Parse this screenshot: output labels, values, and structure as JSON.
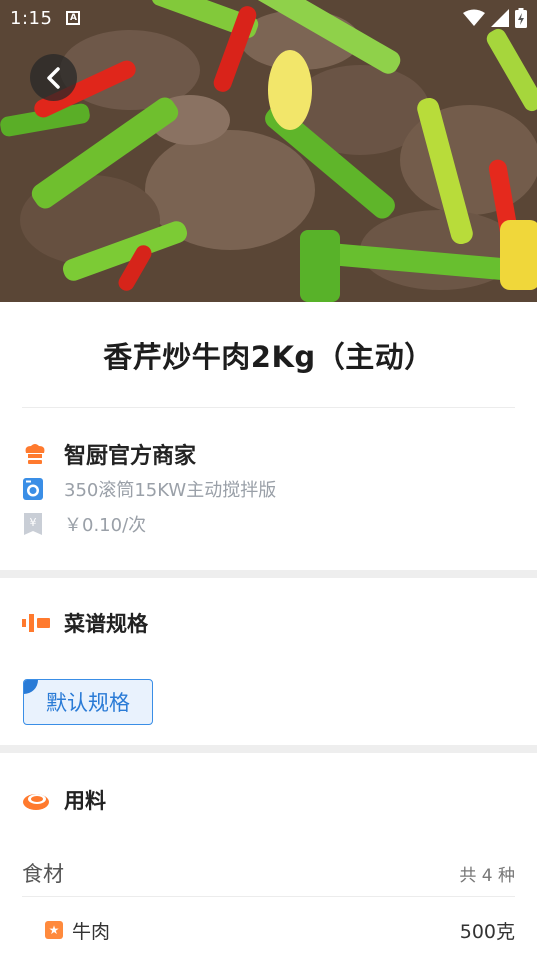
{
  "status_bar": {
    "time": "1:15",
    "badge": "A"
  },
  "recipe": {
    "title": "香芹炒牛肉2Kg（主动）"
  },
  "merchant": {
    "name": "智厨官方商家",
    "device": "350滚筒15KW主动搅拌版",
    "price": "￥0.10/次"
  },
  "spec_section": {
    "title": "菜谱规格",
    "selected_spec": "默认规格"
  },
  "ingredients_section": {
    "title": "用料",
    "category_label": "食材",
    "count_label": "共 4 种",
    "items": [
      {
        "name": "牛肉",
        "amount": "500克"
      }
    ]
  },
  "colors": {
    "accent_orange": "#ff7a2e",
    "accent_blue": "#2a7bd6",
    "separator": "#eeeeee"
  }
}
